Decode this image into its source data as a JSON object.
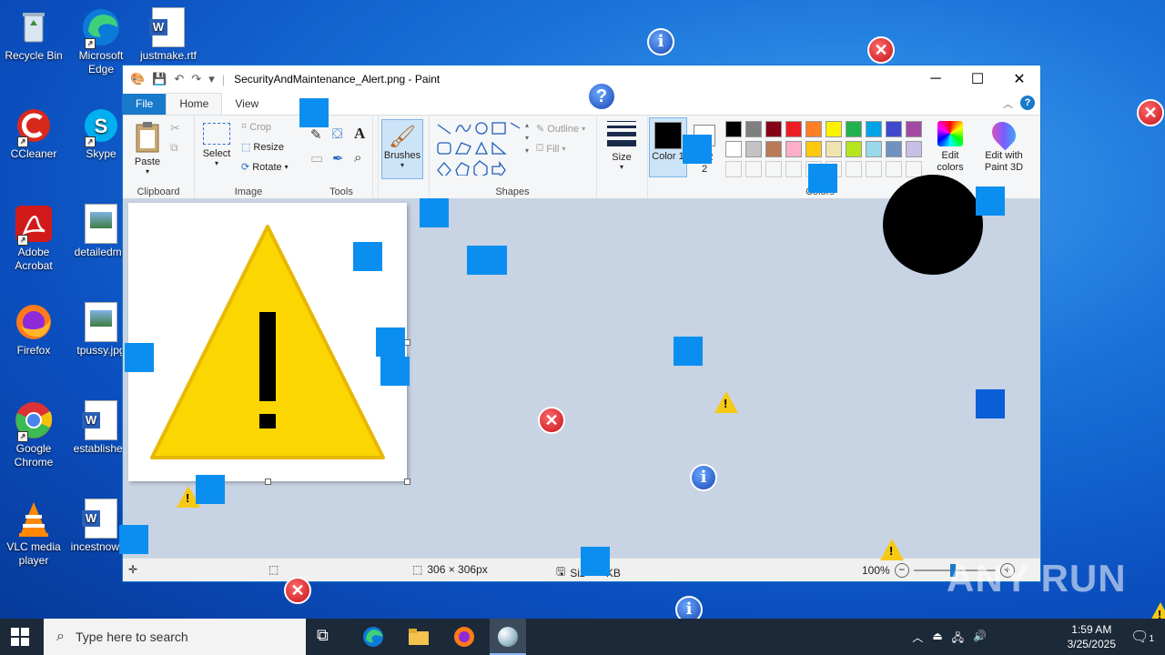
{
  "desktop": {
    "icons": [
      {
        "label": "Recycle Bin",
        "icon": "recycle-bin-icon"
      },
      {
        "label": "Microsoft Edge",
        "icon": "edge-icon"
      },
      {
        "label": "justmake.rtf",
        "icon": "word-doc-icon"
      },
      {
        "label": "CCleaner",
        "icon": "ccleaner-icon"
      },
      {
        "label": "Skype",
        "icon": "skype-icon"
      },
      {
        "label": "Adobe Acrobat",
        "icon": "acrobat-icon"
      },
      {
        "label": "detailedma",
        "icon": "image-file-icon"
      },
      {
        "label": "Firefox",
        "icon": "firefox-icon"
      },
      {
        "label": "tpussy.jpg",
        "icon": "image-file-icon"
      },
      {
        "label": "Google Chrome",
        "icon": "chrome-icon"
      },
      {
        "label": "established",
        "icon": "word-doc-icon"
      },
      {
        "label": "VLC media player",
        "icon": "vlc-icon"
      },
      {
        "label": "incestnow.rtf",
        "icon": "word-doc-icon"
      }
    ]
  },
  "paint": {
    "title": "SecurityAndMaintenance_Alert.png - Paint",
    "tabs": [
      "File",
      "Home",
      "View"
    ],
    "ribbon": {
      "clipboard": {
        "paste": "Paste",
        "label": "Clipboard"
      },
      "image": {
        "select": "Select",
        "crop": "Crop",
        "resize": "Resize",
        "rotate": "Rotate",
        "label": "Image"
      },
      "tools": {
        "label": "Tools"
      },
      "brushes": "Brushes",
      "shapes": {
        "outline": "Outline",
        "fill": "Fill",
        "label": "Shapes"
      },
      "size": "Size",
      "colors": {
        "color1": "Color 1",
        "color2": "or 2",
        "color2_num": "2",
        "edit_colors": "Edit colors",
        "edit_paint3d": "Edit with Paint 3D",
        "label": "Colors",
        "color1_num": "1"
      },
      "palette_row1": [
        "#000000",
        "#7f7f7f",
        "#880015",
        "#ed1c24",
        "#ff7f27",
        "#fff200",
        "#22b14c",
        "#00a2e8",
        "#3f48cc",
        "#a349a4"
      ],
      "palette_row2": [
        "#ffffff",
        "#c3c3c3",
        "#b97a57",
        "#ffaec9",
        "#ffc90e",
        "#efe4b0",
        "#b5e61d",
        "#99d9ea",
        "#7092be",
        "#c8bfe7"
      ]
    },
    "status": {
      "dimensions": "306 × 306px",
      "size": "Siz",
      "size_unit": "KB",
      "zoom": "100%"
    }
  },
  "taskbar": {
    "search_placeholder": "Type here to search",
    "time": "1:59 AM",
    "date": "3/25/2025",
    "notification_count": "1"
  },
  "watermark": "ANY RUN"
}
